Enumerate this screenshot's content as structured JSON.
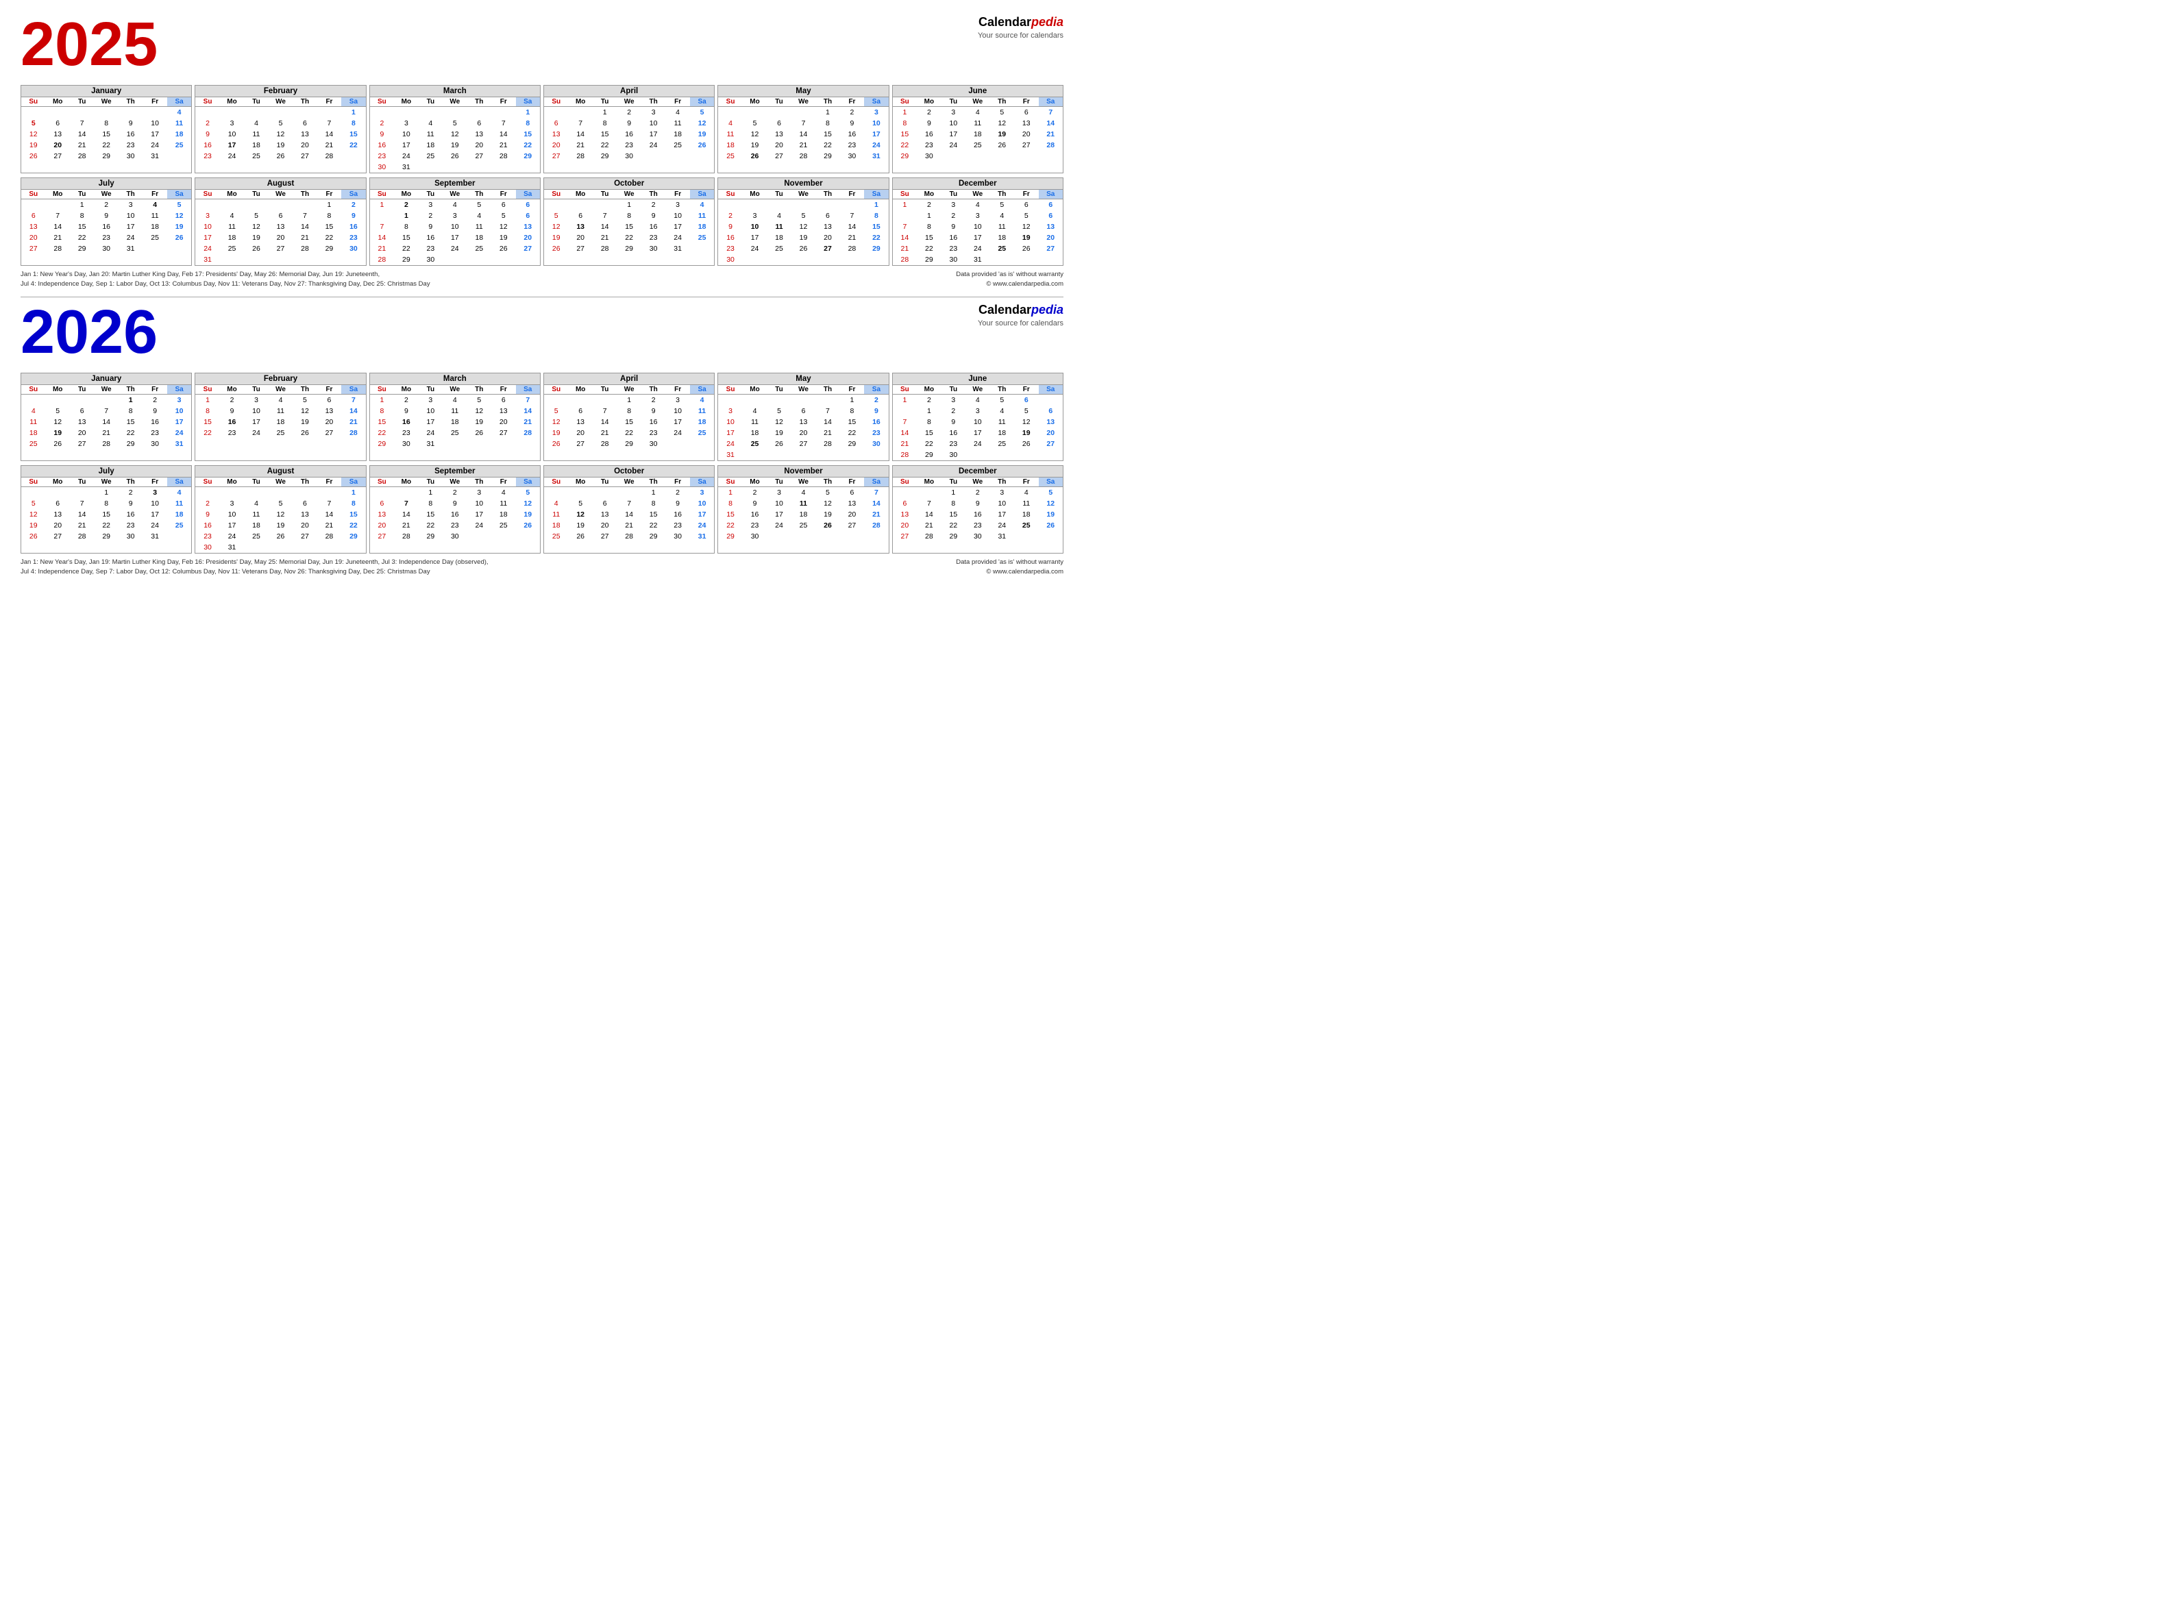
{
  "brand": {
    "name1": "Calendar",
    "name2": "pedia",
    "sub": "Your source for calendars",
    "url": "© www.calendarpedia.com",
    "data_note": "Data provided 'as is' without warranty"
  },
  "year2025": {
    "title": "2025",
    "holidays_line1": "Jan 1: New Year's Day, Jan 20: Martin Luther King Day, Feb 17: Presidents' Day, May 26: Memorial Day, Jun 19: Juneteenth,",
    "holidays_line2": "Jul 4: Independence Day, Sep 1: Labor Day, Oct 13: Columbus Day, Nov 11: Veterans Day, Nov 27: Thanksgiving Day, Dec 25: Christmas Day"
  },
  "year2026": {
    "title": "2026",
    "holidays_line1": "Jan 1: New Year's Day, Jan 19: Martin Luther King Day, Feb 16: Presidents' Day, May 25: Memorial Day, Jun 19: Juneteenth, Jul 3: Independence Day (observed),",
    "holidays_line2": "Jul 4: Independence Day, Sep 7: Labor Day, Oct 12: Columbus Day, Nov 11: Veterans Day, Nov 26: Thanksgiving Day, Dec 25: Christmas Day"
  },
  "dow_labels": [
    "Su",
    "Mo",
    "Tu",
    "We",
    "Th",
    "Fr",
    "Sa"
  ]
}
